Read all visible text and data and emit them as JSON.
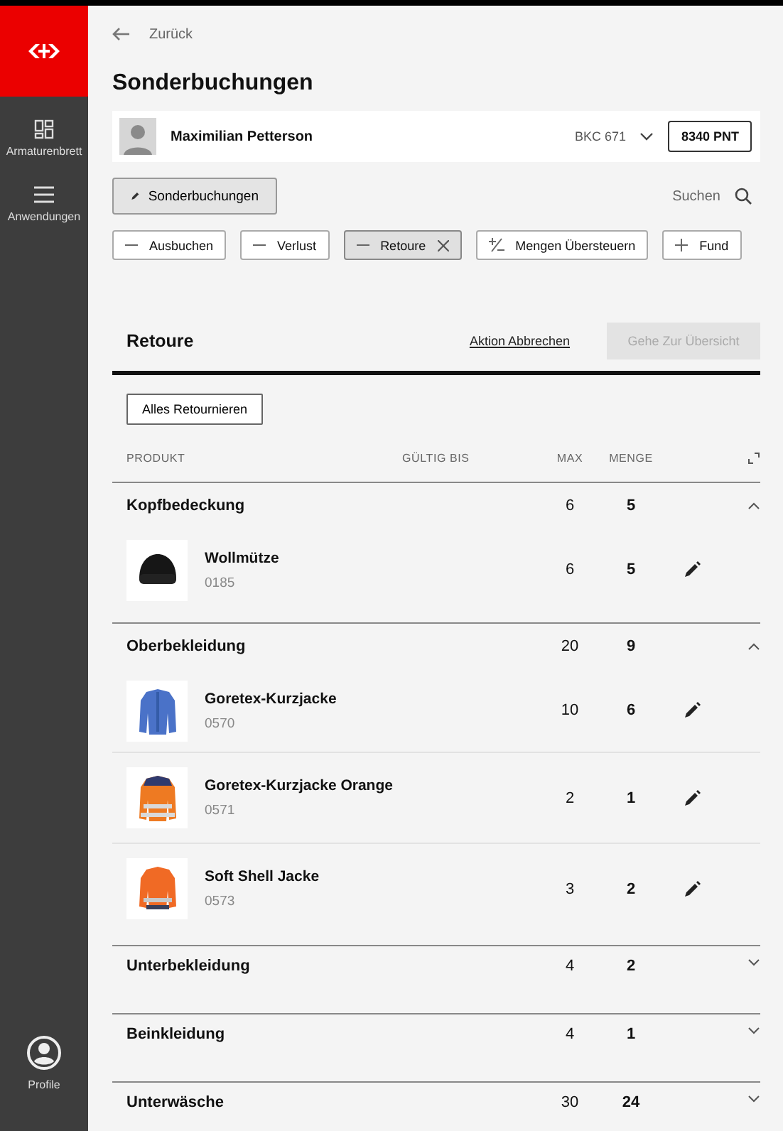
{
  "sidebar": {
    "items": [
      {
        "label": "Armaturenbrett",
        "kind": "dashboard",
        "selected": false
      },
      {
        "label": "Anwendungen",
        "kind": "menu",
        "selected": false
      }
    ],
    "profile": {
      "label": "Profile"
    }
  },
  "back_link": "Zurück",
  "page_title": "Sonderbuchungen",
  "customer": {
    "name": "Maximilian Petterson",
    "code": "BKC 671",
    "points": "8340 PNT"
  },
  "mode_button": "Sonderbuchungen",
  "search": {
    "label": "Suchen"
  },
  "actions": [
    {
      "label": "Ausbuchen",
      "kind": "minus",
      "selected": false
    },
    {
      "label": "Verlust",
      "kind": "minus",
      "selected": false
    },
    {
      "label": "Retoure",
      "kind": "minus",
      "selected": true
    },
    {
      "label": "Mengen Übersteuern",
      "kind": "plusminus",
      "selected": false
    },
    {
      "label": "Fund",
      "kind": "plus",
      "selected": false
    }
  ],
  "section": {
    "title": "Retoure",
    "cancel_link": "Aktion Abbrechen",
    "next_button": {
      "label": "Gehe Zur Übersicht",
      "disabled": true
    }
  },
  "return_all_button": "Alles Retournieren",
  "table": {
    "columns": [
      "PRODUKT",
      "GÜLTIG BIS",
      "MAX",
      "MENGE"
    ],
    "groups": [
      {
        "name": "Kopfbedeckung",
        "max": "6",
        "menge": "5",
        "expanded": true,
        "items": [
          {
            "name": "Wollmütze",
            "code": "0185",
            "max": "6",
            "menge": "5",
            "kind": "picture"
          }
        ]
      },
      {
        "name": "Oberbekleidung",
        "max": "20",
        "menge": "9",
        "expanded": true,
        "items": [
          {
            "name": "Goretex-Kurzjacke",
            "code": "0570",
            "max": "10",
            "menge": "6",
            "kind": "picture"
          },
          {
            "name": "Goretex-Kurzjacke Orange",
            "code": "0571",
            "max": "2",
            "menge": "1",
            "kind": "picture"
          },
          {
            "name": "Soft Shell Jacke",
            "code": "0573",
            "max": "3",
            "menge": "2",
            "kind": "picture"
          }
        ]
      },
      {
        "name": "Unterbekleidung",
        "max": "4",
        "menge": "2",
        "expanded": false
      },
      {
        "name": "Beinkleidung",
        "max": "4",
        "menge": "1",
        "expanded": false
      },
      {
        "name": "Unterwäsche",
        "max": "30",
        "menge": "24",
        "expanded": false
      }
    ]
  }
}
